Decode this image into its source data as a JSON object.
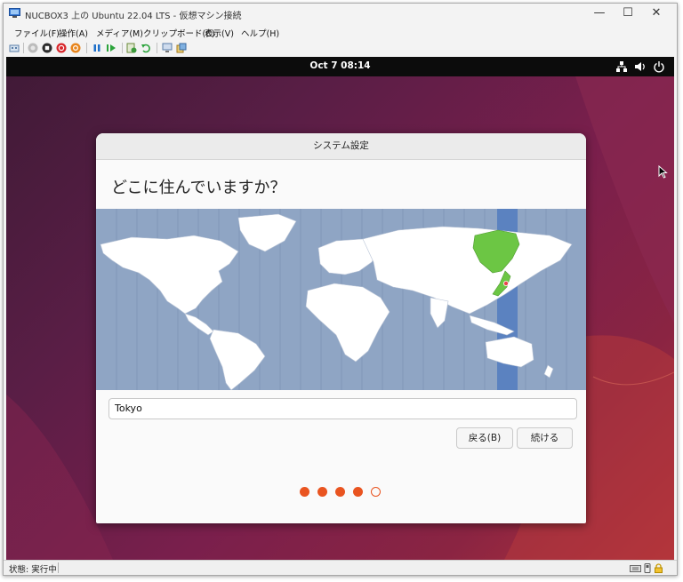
{
  "window": {
    "title": "NUCBOX3 上の Ubuntu 22.04 LTS - 仮想マシン接続",
    "controls": {
      "minimize": "—",
      "maximize": "☐",
      "close": "✕"
    }
  },
  "menu": {
    "items": [
      "ファイル(F)",
      "操作(A)",
      "メディア(M)",
      "クリップボード(C)",
      "表示(V)",
      "ヘルプ(H)"
    ]
  },
  "toolbar": {
    "icons": [
      "ctrl-alt-del-icon",
      "start-icon",
      "turn-off-icon",
      "shutdown-icon",
      "save-state-icon",
      "pause-icon",
      "resume-icon",
      "checkpoint-icon",
      "revert-icon",
      "enhanced-session-icon",
      "share-icon"
    ]
  },
  "guest": {
    "clock": "Oct 7  08:14",
    "tray_icons": [
      "network-icon",
      "volume-icon",
      "power-icon"
    ]
  },
  "dialog": {
    "title": "システム設定",
    "question": "どこに住んでいますか？",
    "timezone_value": "Tokyo",
    "back_label": "戻る(B)",
    "continue_label": "続ける",
    "progress": {
      "completed": 4,
      "total": 5
    }
  },
  "colors": {
    "ubuntu_orange": "#e95420",
    "map_ocean": "#8fa5c4",
    "selected_zone": "#5b82c0",
    "selected_region": "#6cc644"
  },
  "statusbar": {
    "text": "状態: 実行中",
    "icons": [
      "keyboard-icon",
      "usb-icon",
      "lock-icon"
    ]
  }
}
